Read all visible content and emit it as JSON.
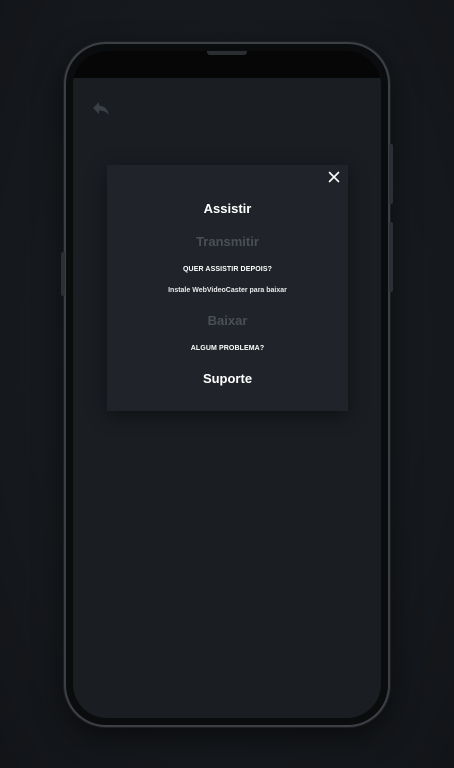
{
  "screen": {
    "back_icon": "reply-arrow-icon"
  },
  "modal": {
    "close_icon": "close-icon",
    "watch_label": "Assistir",
    "cast_label": "Transmitir",
    "later_heading": "QUER ASSISTIR DEPOIS?",
    "install_hint": "Instale WebVideoCaster para baixar",
    "download_label": "Baixar",
    "problem_heading": "ALGUM PROBLEMA?",
    "support_label": "Suporte"
  },
  "colors": {
    "background": "#16191e",
    "screen": "#1a1d22",
    "modal": "#20242a",
    "text_primary": "#ffffff",
    "text_disabled": "#4a4e55"
  }
}
